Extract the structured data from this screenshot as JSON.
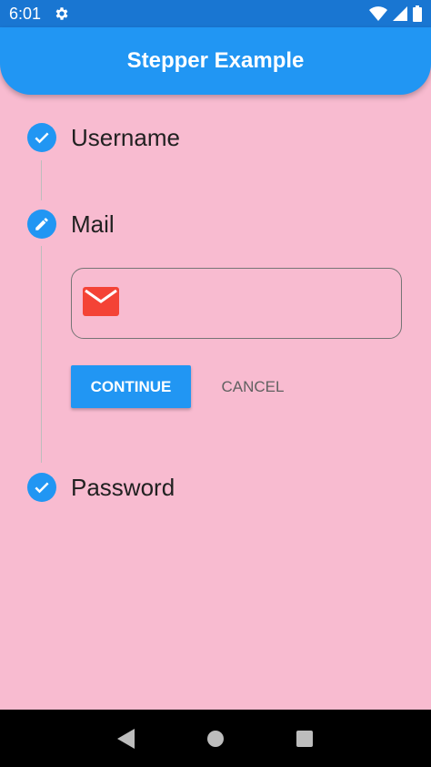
{
  "status_bar": {
    "time": "6:01",
    "icons": [
      "gear-icon",
      "wifi-icon",
      "signal-icon",
      "battery-icon"
    ]
  },
  "app_bar": {
    "title": "Stepper Example"
  },
  "steps": [
    {
      "title": "Username",
      "state": "complete",
      "icon": "check-icon"
    },
    {
      "title": "Mail",
      "state": "editing",
      "icon": "pencil-icon"
    },
    {
      "title": "Password",
      "state": "complete",
      "icon": "check-icon"
    }
  ],
  "mail_step": {
    "field_icon": "mail-icon",
    "value": "",
    "continue_label": "CONTINUE",
    "cancel_label": "CANCEL"
  },
  "nav_bar": {
    "icons": [
      "back-icon",
      "home-icon",
      "recents-icon"
    ]
  },
  "colors": {
    "background": "#f8bbd0",
    "primary": "#2196f3",
    "status_bar": "#1976d2",
    "mail_icon": "#f44336"
  }
}
